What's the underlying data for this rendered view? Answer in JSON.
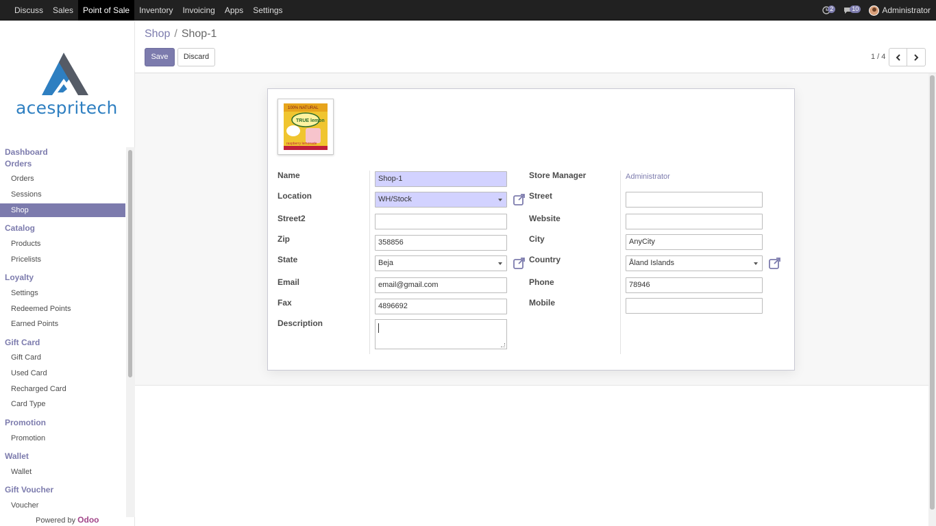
{
  "topnav": {
    "items": [
      "Discuss",
      "Sales",
      "Point of Sale",
      "Inventory",
      "Invoicing",
      "Apps",
      "Settings"
    ],
    "active": "Point of Sale",
    "activity_count": "2",
    "messages_count": "10",
    "user": "Administrator"
  },
  "sidebar": {
    "logo_text": "acespritech",
    "sections": [
      {
        "label": "Dashboard",
        "items": []
      },
      {
        "label": "Orders",
        "items": [
          "Orders",
          "Sessions",
          "Shop"
        ]
      },
      {
        "label": "Catalog",
        "items": [
          "Products",
          "Pricelists"
        ]
      },
      {
        "label": "Loyalty",
        "items": [
          "Settings",
          "Redeemed Points",
          "Earned Points"
        ]
      },
      {
        "label": "Gift Card",
        "items": [
          "Gift Card",
          "Used Card",
          "Recharged Card",
          "Card Type"
        ]
      },
      {
        "label": "Promotion",
        "items": [
          "Promotion"
        ]
      },
      {
        "label": "Wallet",
        "items": [
          "Wallet"
        ]
      },
      {
        "label": "Gift Voucher",
        "items": [
          "Voucher"
        ]
      }
    ],
    "active_item": "Shop",
    "powered_by": "Powered by",
    "powered_brand": "Odoo"
  },
  "breadcrumb": {
    "parent": "Shop",
    "separator": "/",
    "current": "Shop-1"
  },
  "actions": {
    "save": "Save",
    "discard": "Discard"
  },
  "pager": {
    "text": "1 / 4"
  },
  "form": {
    "labels": {
      "name": "Name",
      "location": "Location",
      "street2": "Street2",
      "zip": "Zip",
      "state": "State",
      "email": "Email",
      "fax": "Fax",
      "description": "Description",
      "store_manager": "Store Manager",
      "street": "Street",
      "website": "Website",
      "city": "City",
      "country": "Country",
      "phone": "Phone",
      "mobile": "Mobile"
    },
    "values": {
      "name": "Shop-1",
      "location": "WH/Stock",
      "street2": "",
      "zip": "358856",
      "state": "Beja",
      "email": "email@gmail.com",
      "fax": "4896692",
      "description": "",
      "store_manager": "Administrator",
      "street": "",
      "website": "",
      "city": "AnyCity",
      "country": "Åland Islands",
      "phone": "78946",
      "mobile": ""
    },
    "image_caption": {
      "top": "100% NATURAL",
      "brand": "TRUE lemon",
      "flavor": "raspberry lemonade"
    }
  },
  "colors": {
    "accent": "#7c7bad",
    "required_bg": "#d2d2ff",
    "topbar": "#212121",
    "odoo": "#a24689"
  }
}
